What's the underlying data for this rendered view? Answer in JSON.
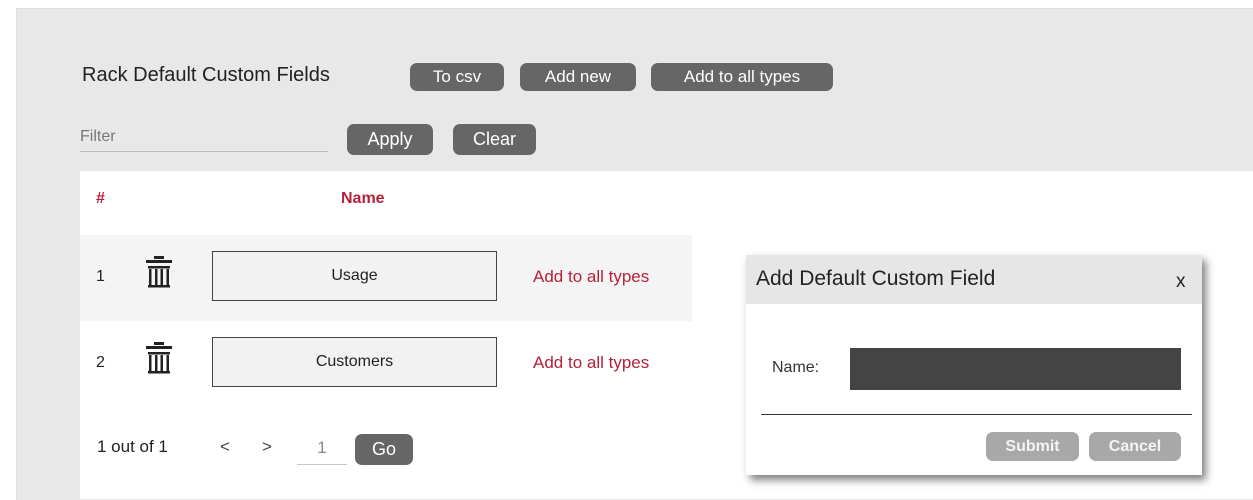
{
  "header": {
    "title": "Rack Default Custom Fields",
    "to_csv": "To csv",
    "add_new": "Add new",
    "add_to_all_types": "Add to all types"
  },
  "filter": {
    "placeholder": "Filter",
    "apply": "Apply",
    "clear": "Clear"
  },
  "table": {
    "columns": [
      "#",
      "Name"
    ],
    "rows": [
      {
        "num": "1",
        "name": "Usage",
        "action": "Add to all types"
      },
      {
        "num": "2",
        "name": "Customers",
        "action": "Add to all types"
      }
    ]
  },
  "pagination": {
    "summary": "1 out of 1",
    "prev": "<",
    "next": ">",
    "page": "1",
    "go": "Go"
  },
  "modal": {
    "title": "Add Default Custom Field",
    "close": "x",
    "name_label": "Name:",
    "submit": "Submit",
    "cancel": "Cancel"
  },
  "icons": {
    "delete": "trash-icon"
  },
  "colors": {
    "accent": "#b5213b",
    "button": "#666666",
    "button_disabled": "#a8a8a8",
    "panel": "#e8e8e8",
    "input_dark": "#444444"
  }
}
